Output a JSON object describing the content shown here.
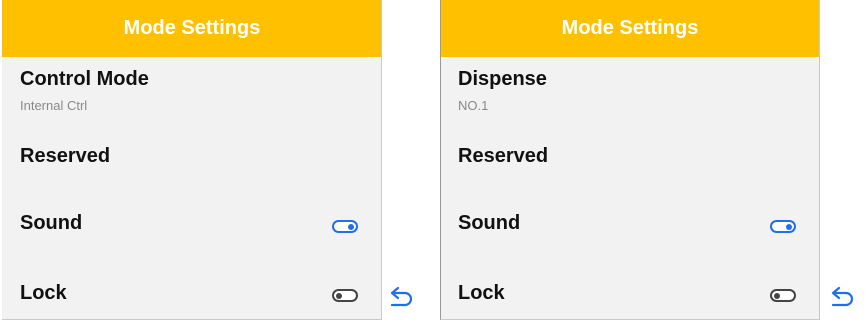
{
  "left_panel": {
    "header_title": "Mode Settings",
    "items": [
      {
        "title": "Control Mode",
        "subtitle": "Internal Ctrl"
      },
      {
        "title": "Reserved"
      },
      {
        "title": "Sound",
        "toggle": true
      },
      {
        "title": "Lock",
        "toggle": false
      }
    ]
  },
  "right_panel": {
    "header_title": "Mode Settings",
    "items": [
      {
        "title": "Dispense",
        "subtitle": "NO.1"
      },
      {
        "title": "Reserved"
      },
      {
        "title": "Sound",
        "toggle": true
      },
      {
        "title": "Lock",
        "toggle": false
      }
    ]
  },
  "icons": {
    "back": "back-arrow-icon"
  },
  "colors": {
    "header": "#ffc000",
    "toggle_on": "#1e6ff0",
    "toggle_off": "#444444",
    "back_icon": "#1e6ff0"
  }
}
